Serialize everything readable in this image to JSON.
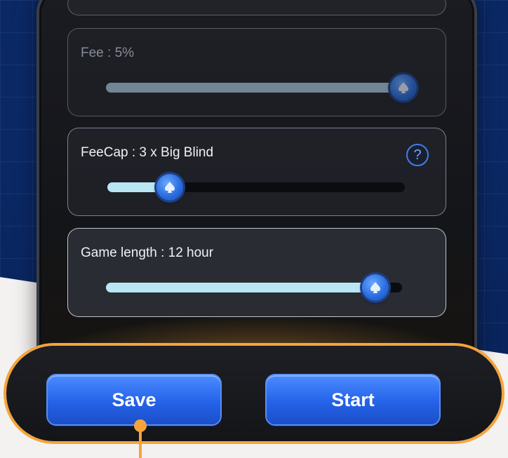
{
  "settings": {
    "fee": {
      "label": "Fee : 5%",
      "slider_value": 0.99,
      "enabled": false
    },
    "feecap": {
      "label": "FeeCap : 3 x Big Blind",
      "slider_value": 0.21,
      "help_icon": "question-mark-icon",
      "help_glyph": "?"
    },
    "game_length": {
      "label": "Game length : 12 hour",
      "slider_value": 0.91
    }
  },
  "actions": {
    "save_label": "Save",
    "start_label": "Start"
  },
  "theme": {
    "accent": "#f5a43a",
    "button_blue": "#2462e8",
    "slider_fill": "#b9e6f5",
    "background_blue": "#0d2f73"
  }
}
